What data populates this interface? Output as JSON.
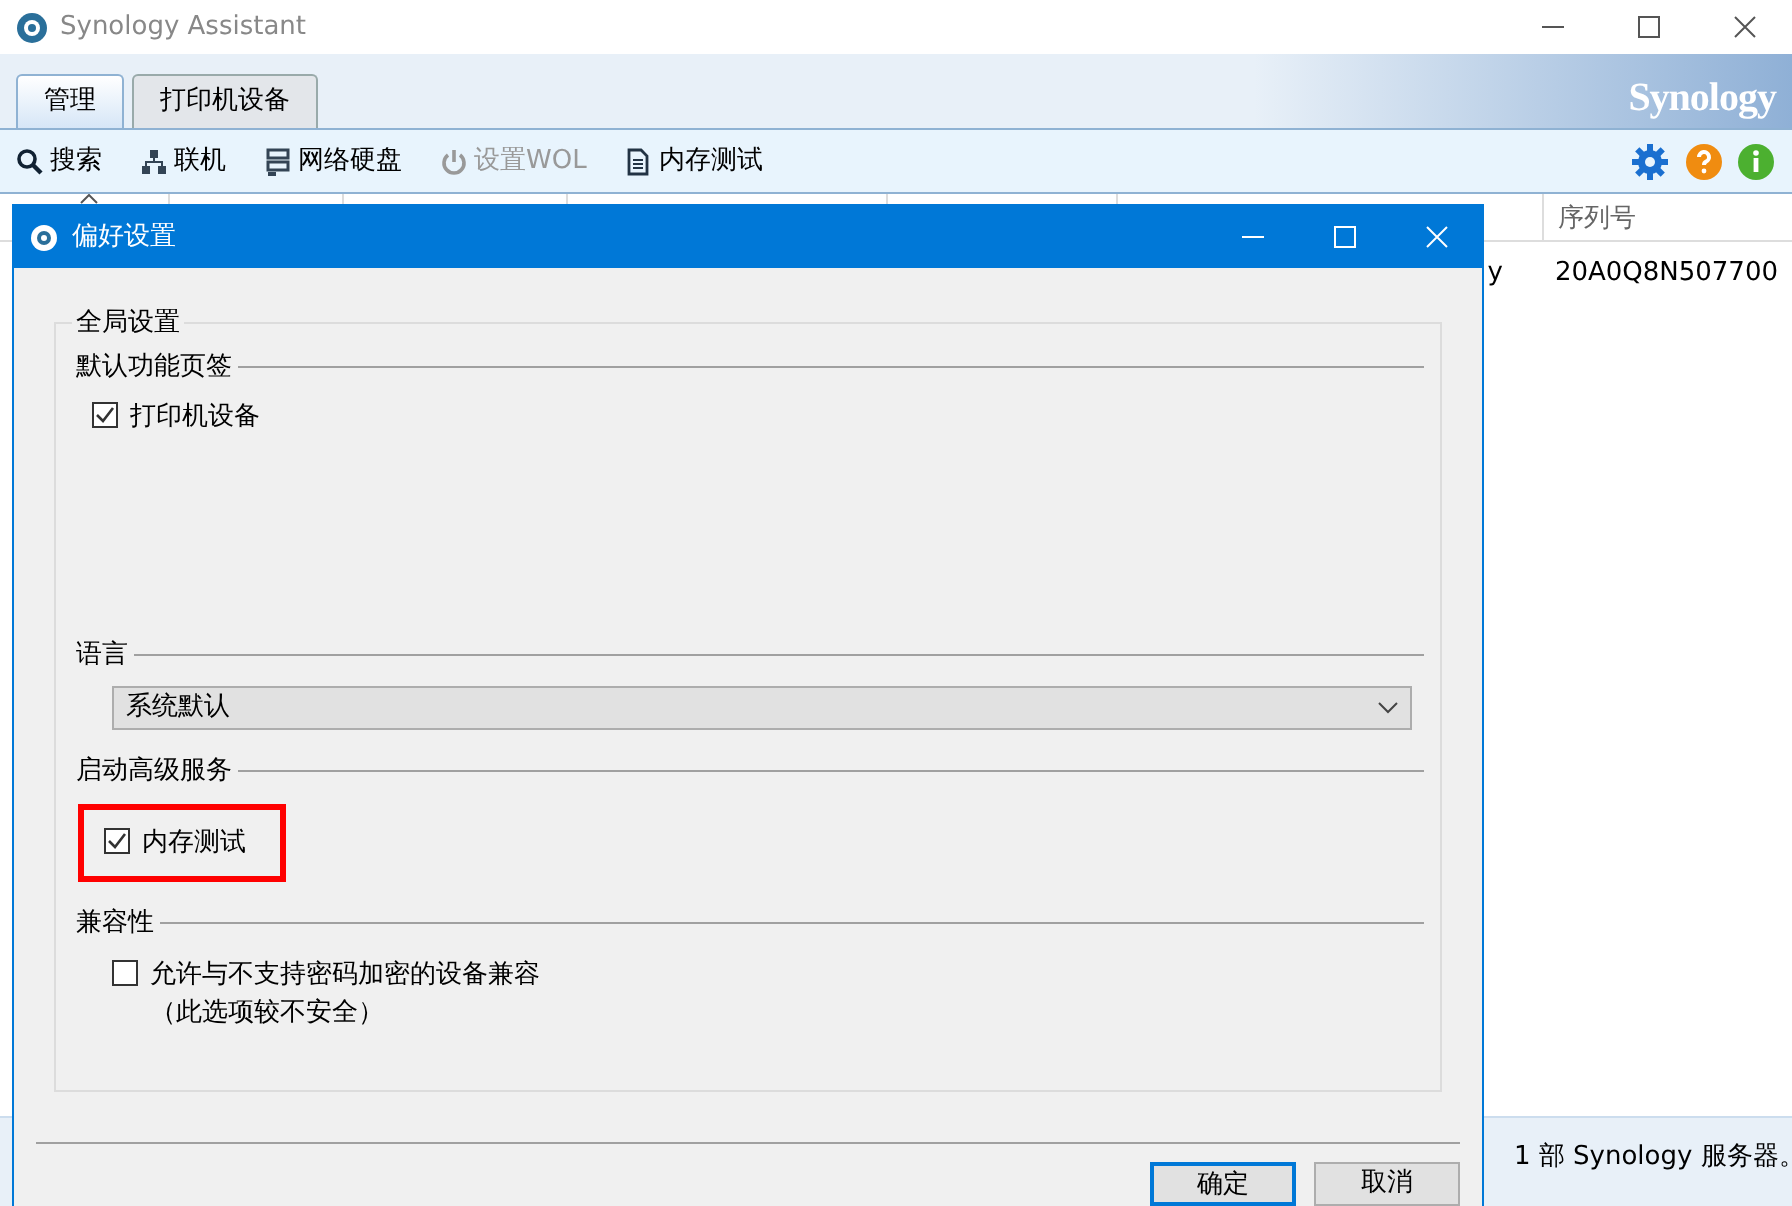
{
  "window": {
    "title": "Synology Assistant"
  },
  "tabs": [
    {
      "label": "管理",
      "selected": true
    },
    {
      "label": "打印机设备",
      "selected": false
    }
  ],
  "logo": "Synology",
  "toolbar": [
    {
      "label": "搜索",
      "disabled": false
    },
    {
      "label": "联机",
      "disabled": false
    },
    {
      "label": "网络硬盘",
      "disabled": false
    },
    {
      "label": "设置WOL",
      "disabled": true
    },
    {
      "label": "内存测试",
      "disabled": false
    }
  ],
  "table": {
    "columns": [
      {
        "label": "序列号"
      }
    ],
    "rows": [
      {
        "cut_off_text": "y",
        "cells": [
          "20A0Q8N507700"
        ]
      }
    ]
  },
  "status_bar": "1 部 Synology 服务器。",
  "dialog": {
    "title": "偏好设置",
    "group": "全局设置",
    "sections": [
      {
        "title": "默认功能页签",
        "items": [
          {
            "kind": "checkbox",
            "label": "打印机设备",
            "checked": true
          }
        ]
      },
      {
        "title": "语言",
        "items": [
          {
            "kind": "select",
            "value": "系统默认"
          }
        ]
      },
      {
        "title": "启动高级服务",
        "items": [
          {
            "kind": "checkbox",
            "label": "内存测试",
            "checked": true,
            "highlighted": true
          }
        ]
      },
      {
        "title": "兼容性",
        "items": [
          {
            "kind": "checkbox",
            "label": "允许与不支持密码加密的设备兼容",
            "note": "（此选项较不安全）",
            "checked": false
          }
        ]
      }
    ],
    "buttons": [
      {
        "label": "确定",
        "default": true
      },
      {
        "label": "取消",
        "default": false
      }
    ]
  }
}
